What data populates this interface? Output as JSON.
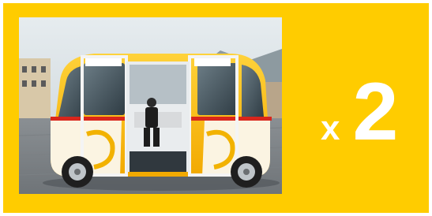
{
  "image": {
    "subject": "autonomous-shuttle-bus",
    "accent_color": "#FFCC00",
    "text_color": "#FFFFFF"
  },
  "multiplier": {
    "symbol": "x",
    "count": "2"
  }
}
